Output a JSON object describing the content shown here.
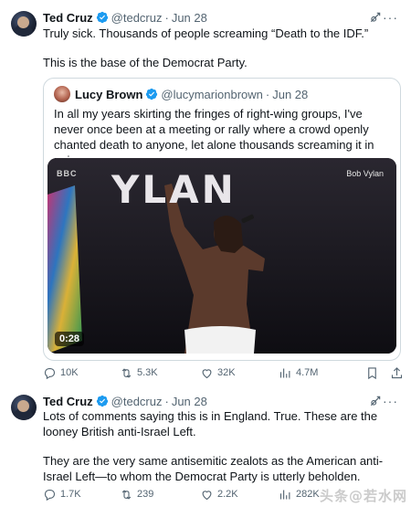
{
  "tweet1": {
    "author": {
      "name": "Ted Cruz",
      "handle": "@tedcruz",
      "separator": "·",
      "date": "Jun 28"
    },
    "text": [
      "Truly sick. Thousands of people screaming “Death to the IDF.”",
      "This is the base of the Democrat Party."
    ],
    "quote": {
      "author": {
        "name": "Lucy Brown",
        "handle": "@lucymarionbrown",
        "separator": "·",
        "date": "Jun 28"
      },
      "text": "In all my years skirting the fringes of right-wing groups, I've never once been at a meeting or rally where a crowd openly chanted death to anyone, let alone thousands screaming it in unison.",
      "video": {
        "stage_text": "YLAN",
        "broadcaster": "BBC",
        "caption": "Bob Vylan",
        "duration": "0:28"
      }
    },
    "stats": {
      "replies": "10K",
      "reposts": "5.3K",
      "likes": "32K",
      "views": "4.7M"
    }
  },
  "tweet2": {
    "author": {
      "name": "Ted Cruz",
      "handle": "@tedcruz",
      "separator": "·",
      "date": "Jun 28"
    },
    "text": [
      "Lots of comments saying this is in England. True. These are the looney British anti-Israel Left.",
      "They are the very same antisemitic zealots as the American anti-Israel Left—to whom the Democrat Party is utterly beholden."
    ],
    "stats": {
      "replies": "1.7K",
      "reposts": "239",
      "likes": "2.2K",
      "views": "282K"
    }
  },
  "watermark": "头条@若水网",
  "colors": {
    "text": "#0f1419",
    "secondary": "#536471",
    "verified": "#1d9bf0",
    "border": "#cfd9de"
  },
  "icons": [
    "grok-icon",
    "more-icon",
    "verified-icon",
    "reply-icon",
    "repost-icon",
    "like-icon",
    "views-icon",
    "bookmark-icon",
    "share-icon"
  ]
}
